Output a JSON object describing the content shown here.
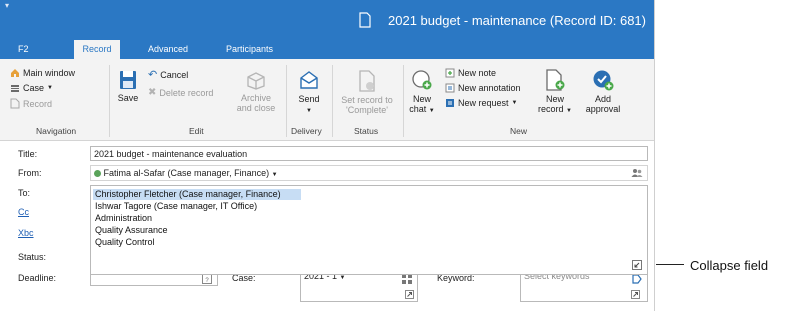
{
  "window": {
    "title": "2021 budget - maintenance (Record ID: 681)",
    "quick_access_glyph": "▾"
  },
  "tabs": [
    {
      "label": "F2",
      "active": false
    },
    {
      "label": "Record",
      "active": true
    },
    {
      "label": "Advanced",
      "active": false
    },
    {
      "label": "Participants",
      "active": false
    }
  ],
  "ribbon": {
    "navigation": {
      "label": "Navigation",
      "main_window": "Main window",
      "case": "Case",
      "record": "Record"
    },
    "edit": {
      "label": "Edit",
      "save": "Save",
      "cancel": "Cancel",
      "delete_record": "Delete record",
      "archive_line1": "Archive",
      "archive_line2": "and close"
    },
    "delivery": {
      "label": "Delivery",
      "send": "Send"
    },
    "status": {
      "label": "Status",
      "set_line1": "Set record to",
      "set_line2": "'Complete'"
    },
    "new": {
      "label": "New",
      "new_chat_line1": "New",
      "new_chat_line2": "chat",
      "new_note": "New note",
      "new_annotation": "New annotation",
      "new_request": "New request",
      "new_record_line1": "New",
      "new_record_line2": "record",
      "add_approval_line1": "Add",
      "add_approval_line2": "approval"
    }
  },
  "form": {
    "title_label": "Title:",
    "title_value": "2021 budget - maintenance evaluation",
    "from_label": "From:",
    "from_value": "Fatima al-Safar (Case manager, Finance)",
    "to_label": "To:",
    "cc_label": "Cc",
    "xbc_label": "Xbc",
    "status_label": "Status:",
    "deadline_label": "Deadline:",
    "case_label": "Case:",
    "case_value": "2021 - 1",
    "keyword_label": "Keyword:",
    "keyword_placeholder": "Select keywords",
    "to_options": [
      {
        "text": "Christopher Fletcher (Case manager, Finance)",
        "selected": true
      },
      {
        "text": "Ishwar Tagore (Case manager, IT Office)",
        "selected": false
      },
      {
        "text": "Administration",
        "selected": false
      },
      {
        "text": "Quality Assurance",
        "selected": false
      },
      {
        "text": "Quality Control",
        "selected": false
      }
    ]
  },
  "annotation": {
    "collapse_field": "Collapse field"
  },
  "colors": {
    "accent": "#2b78c4",
    "selection": "#c7ddf4",
    "green_status": "#5aa35a"
  }
}
